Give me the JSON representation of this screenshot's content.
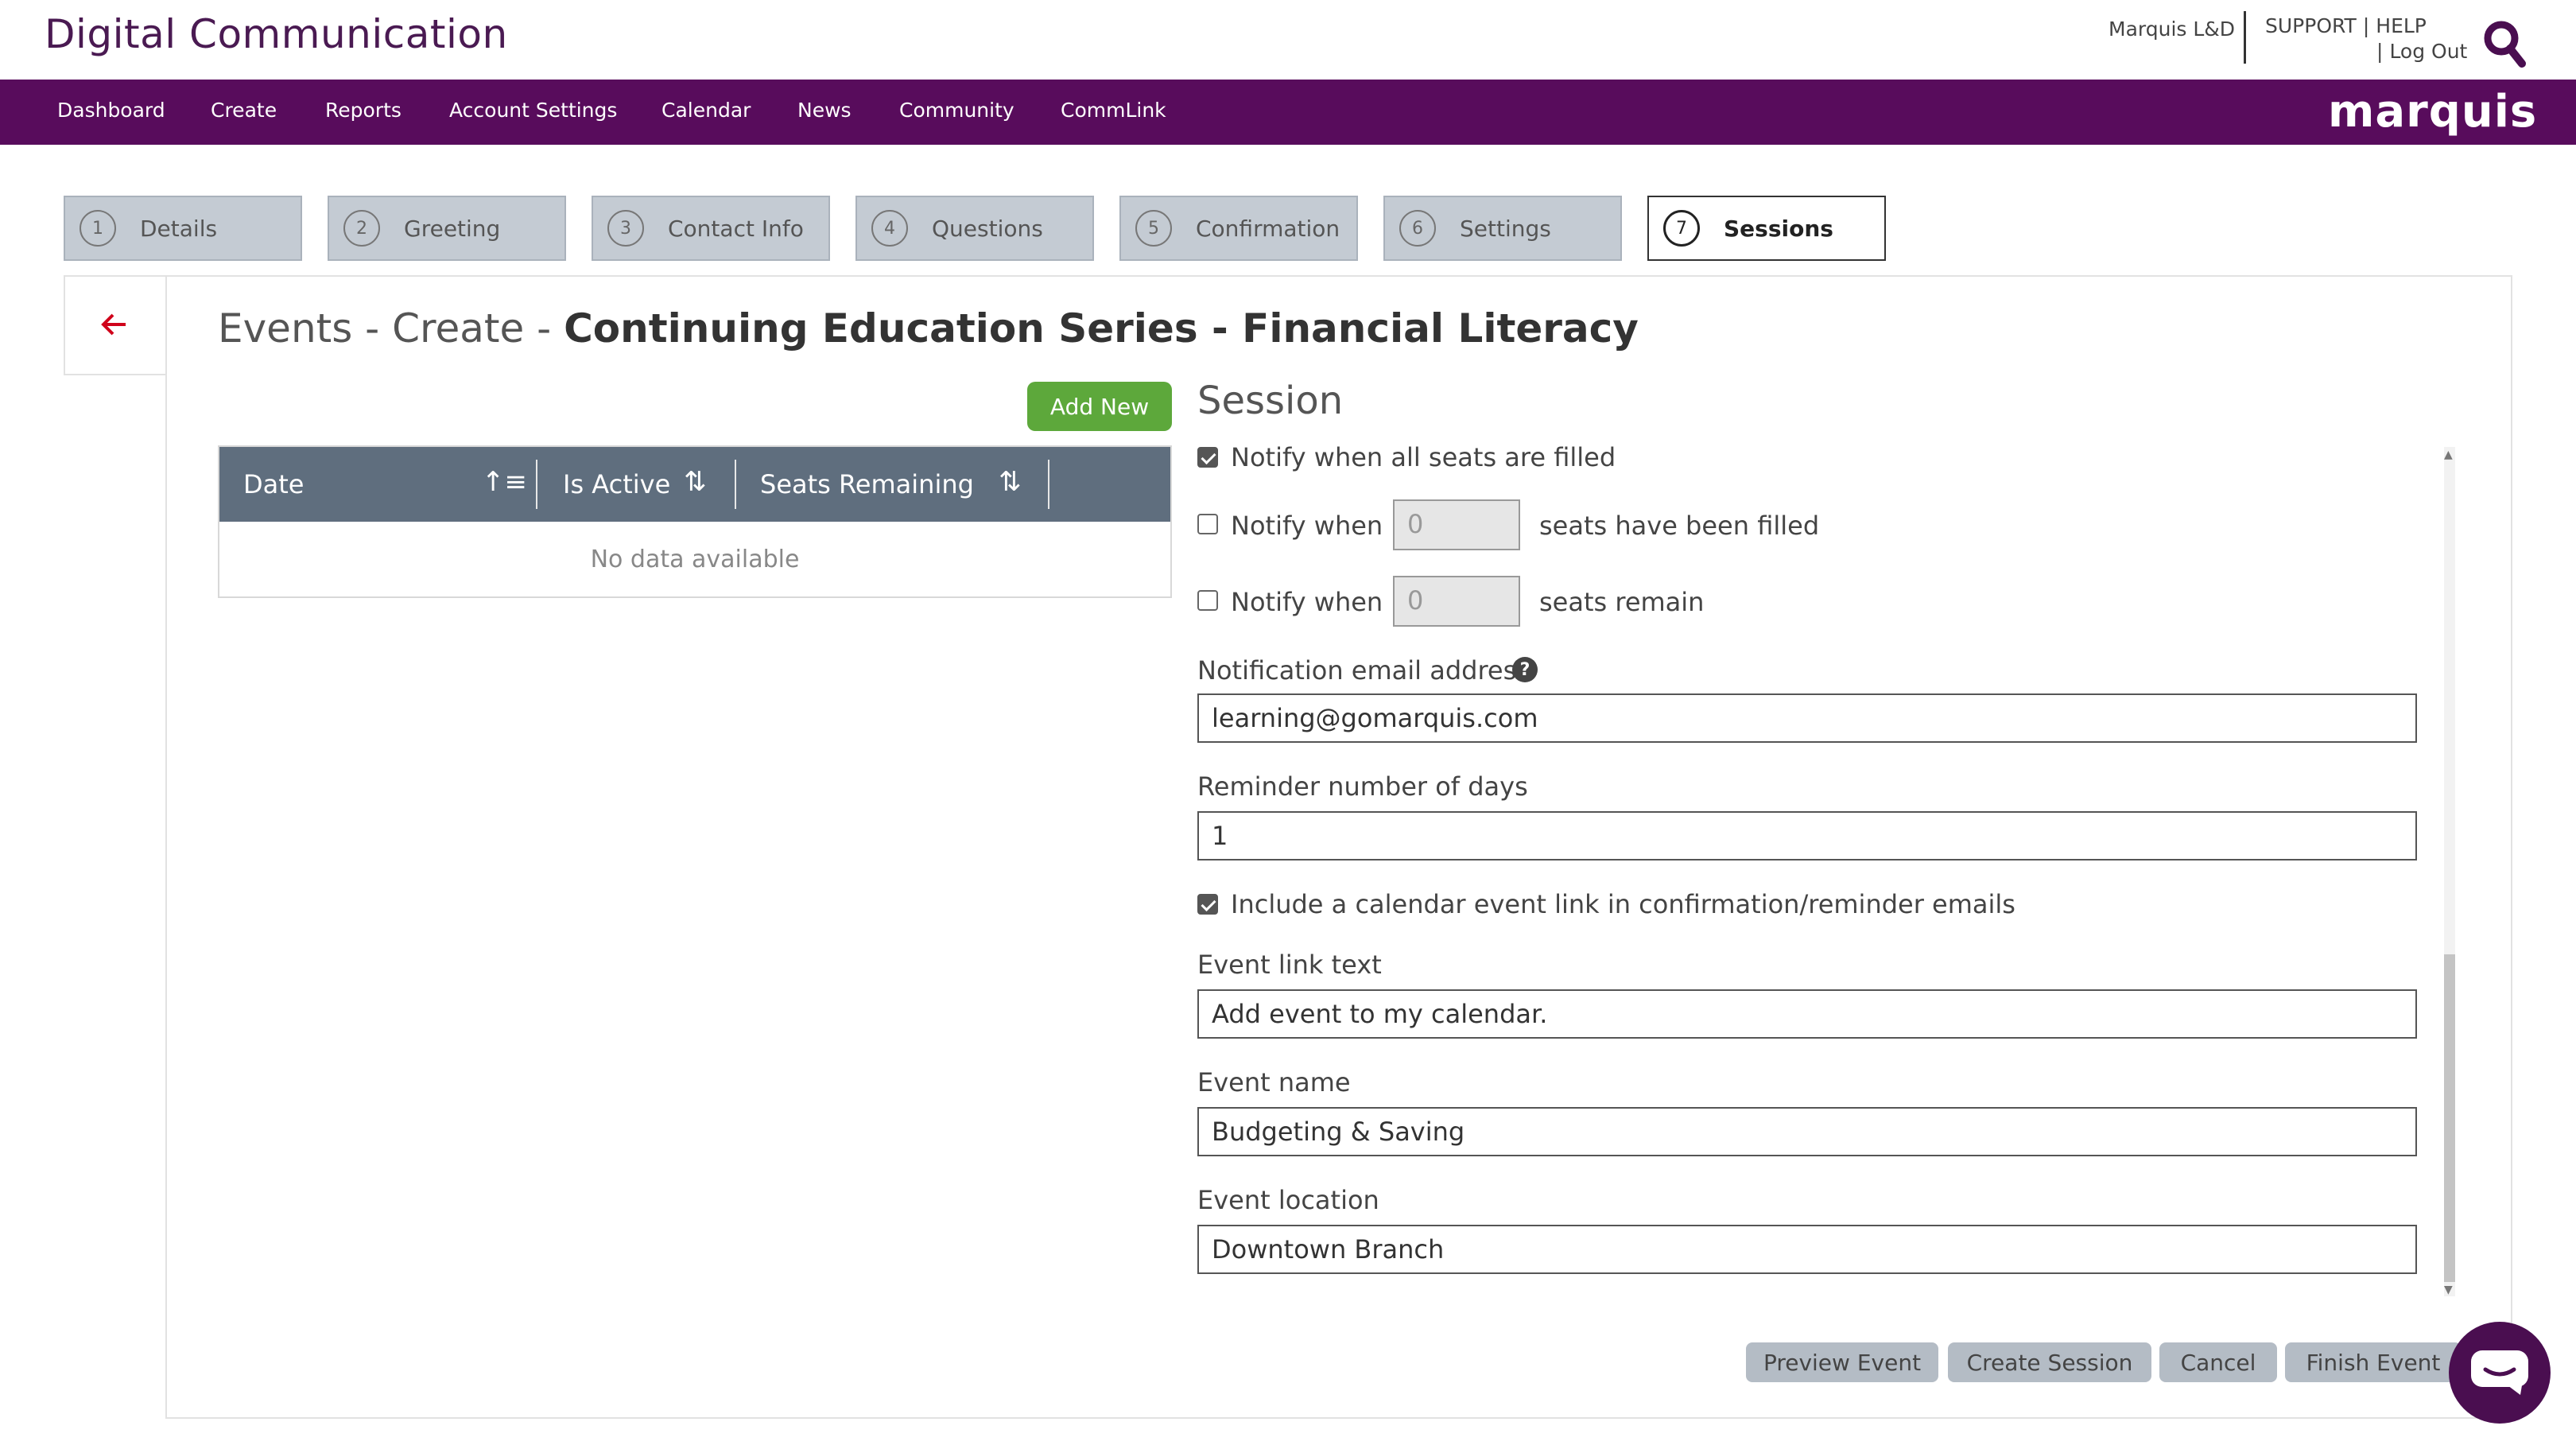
{
  "header": {
    "brand": "Digital Communication",
    "account": "Marquis L&D",
    "support": "SUPPORT",
    "help": "HELP",
    "sep": "|",
    "logout": "Log Out",
    "search_icon": "search-icon",
    "logo": "marquis"
  },
  "nav": {
    "items": [
      "Dashboard",
      "Create",
      "Reports",
      "Account Settings",
      "Calendar",
      "News",
      "Community",
      "CommLink"
    ]
  },
  "steps": [
    {
      "num": "1",
      "label": "Details"
    },
    {
      "num": "2",
      "label": "Greeting"
    },
    {
      "num": "3",
      "label": "Contact Info"
    },
    {
      "num": "4",
      "label": "Questions"
    },
    {
      "num": "5",
      "label": "Confirmation"
    },
    {
      "num": "6",
      "label": "Settings"
    },
    {
      "num": "7",
      "label": "Sessions"
    }
  ],
  "page": {
    "title_prefix": "Events - Create - ",
    "title_bold": "Continuing Education Series - Financial Literacy"
  },
  "table": {
    "add_button": "Add New",
    "columns": [
      "Date",
      "Is Active",
      "Seats Remaining"
    ],
    "empty": "No data available"
  },
  "session": {
    "heading": "Session",
    "notify_all_label": "Notify when all seats are filled",
    "notify_all_checked": true,
    "notify_filled_label": "Notify when",
    "notify_filled_value": "0",
    "notify_filled_suffix": "seats have been filled",
    "notify_filled_checked": false,
    "notify_remain_label": "Notify when",
    "notify_remain_value": "0",
    "notify_remain_suffix": "seats remain",
    "notify_remain_checked": false,
    "email_label": "Notification email address",
    "email_value": "learning@gomarquis.com",
    "reminder_label": "Reminder number of days",
    "reminder_value": "1",
    "calendar_link_label": "Include a calendar event link in confirmation/reminder emails",
    "calendar_link_checked": true,
    "link_text_label": "Event link text",
    "link_text_value": "Add event to my calendar.",
    "event_name_label": "Event name",
    "event_name_value": "Budgeting & Saving",
    "event_location_label": "Event location",
    "event_location_value": "Downtown Branch"
  },
  "footer": {
    "preview": "Preview Event",
    "create_session": "Create Session",
    "cancel": "Cancel",
    "finish": "Finish Event"
  },
  "colors": {
    "brand_purple": "#580c5c",
    "add_green": "#5da83b",
    "table_header": "#5f6e7e"
  }
}
